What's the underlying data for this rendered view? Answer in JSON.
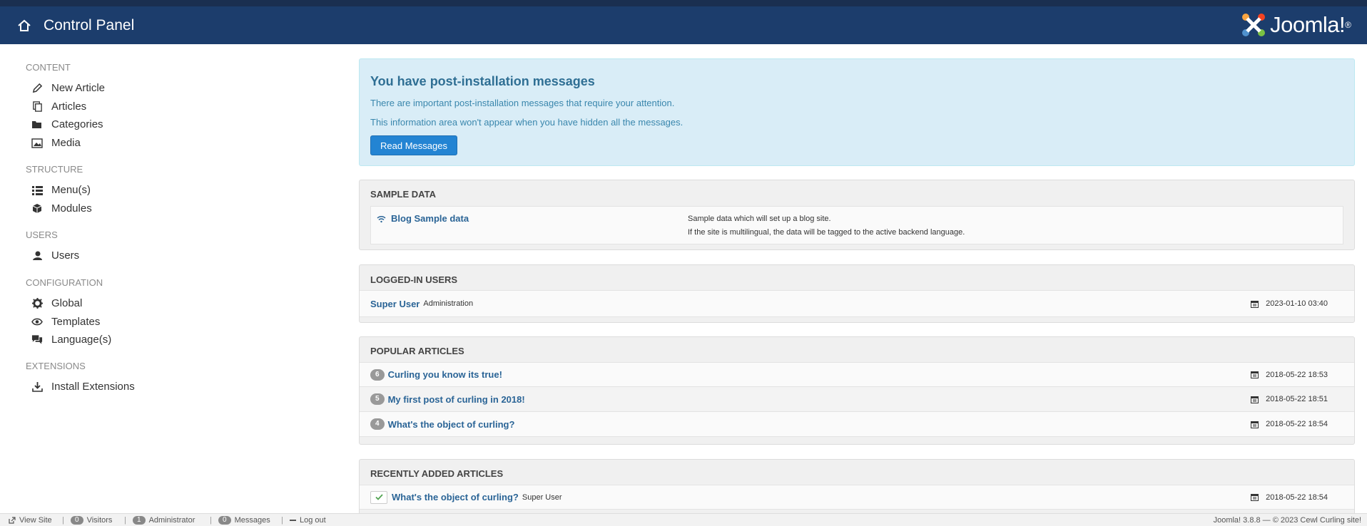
{
  "header": {
    "title": "Control Panel",
    "logo_text": "Joomla!"
  },
  "sidebar": {
    "sections": [
      {
        "label": "CONTENT",
        "items": [
          "New Article",
          "Articles",
          "Categories",
          "Media"
        ]
      },
      {
        "label": "STRUCTURE",
        "items": [
          "Menu(s)",
          "Modules"
        ]
      },
      {
        "label": "USERS",
        "items": [
          "Users"
        ]
      },
      {
        "label": "CONFIGURATION",
        "items": [
          "Global",
          "Templates",
          "Language(s)"
        ]
      },
      {
        "label": "EXTENSIONS",
        "items": [
          "Install Extensions"
        ]
      }
    ]
  },
  "alert": {
    "title": "You have post-installation messages",
    "line1": "There are important post-installation messages that require your attention.",
    "line2": "This information area won't appear when you have hidden all the messages.",
    "button": "Read Messages"
  },
  "sample_data": {
    "title": "SAMPLE DATA",
    "item": "Blog Sample data",
    "desc1": "Sample data which will set up a blog site.",
    "desc2": "If the site is multilingual, the data will be tagged to the active backend language."
  },
  "logged_in": {
    "title": "LOGGED-IN USERS",
    "user": "Super User",
    "client": "Administration",
    "date": "2023-01-10 03:40"
  },
  "popular": {
    "title": "POPULAR ARTICLES",
    "rows": [
      {
        "hits": "6",
        "title": "Curling you know its true!",
        "date": "2018-05-22 18:53"
      },
      {
        "hits": "5",
        "title": "My first post of curling in 2018!",
        "date": "2018-05-22 18:51"
      },
      {
        "hits": "4",
        "title": "What's the object of curling?",
        "date": "2018-05-22 18:54"
      }
    ]
  },
  "recent": {
    "title": "RECENTLY ADDED ARTICLES",
    "rows": [
      {
        "title": "What's the object of curling?",
        "author": "Super User",
        "date": "2018-05-22 18:54"
      }
    ]
  },
  "footer": {
    "view_site": "View Site",
    "visitors_count": "0",
    "visitors": "Visitors",
    "admin_count": "1",
    "admin": "Administrator",
    "messages_count": "0",
    "messages": "Messages",
    "logout": "Log out",
    "right": "Joomla! 3.8.8 — © 2023 Cewl Curling site!"
  },
  "colors": {
    "header": "#1c3d6c",
    "link": "#2a6496",
    "alert_bg": "#d9edf7",
    "primary": "#2384d3"
  }
}
